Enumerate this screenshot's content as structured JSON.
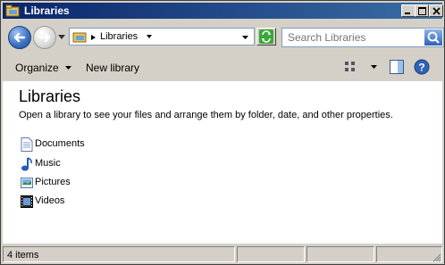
{
  "window": {
    "title": "Libraries"
  },
  "nav": {
    "address_crumb": "Libraries",
    "search_placeholder": "Search Libraries"
  },
  "toolbar": {
    "organize_label": "Organize",
    "new_library_label": "New library"
  },
  "content": {
    "heading": "Libraries",
    "description": "Open a library to see your files and arrange them by folder, date, and other properties.",
    "libraries": [
      {
        "label": "Documents",
        "icon": "documents-icon"
      },
      {
        "label": "Music",
        "icon": "music-icon"
      },
      {
        "label": "Pictures",
        "icon": "pictures-icon"
      },
      {
        "label": "Videos",
        "icon": "videos-icon"
      }
    ]
  },
  "status": {
    "items_count": "4 items"
  },
  "colors": {
    "titlebar": "#0a246a",
    "accent_blue": "#3a6fbf",
    "window_bg": "#d4d0c8"
  }
}
